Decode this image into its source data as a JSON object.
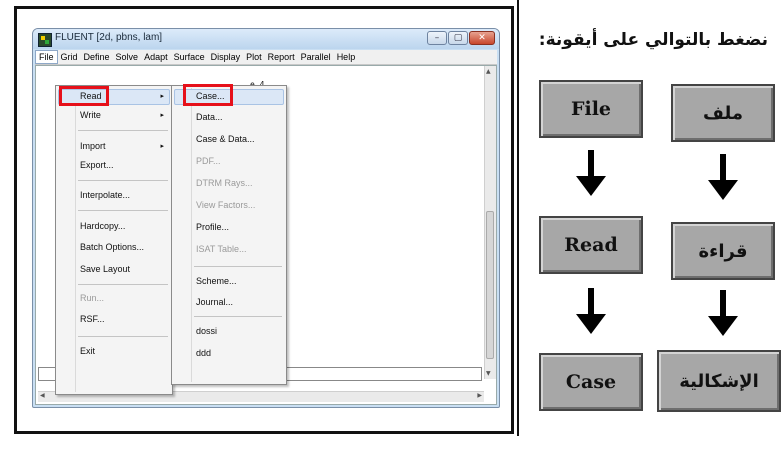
{
  "fluent_window": {
    "title": "FLUENT [2d, pbns, lam]",
    "controls": {
      "minimize": "–",
      "maximize": "▢",
      "close": "✕"
    },
    "menu_bar": [
      "File",
      "Grid",
      "Define",
      "Solve",
      "Adapt",
      "Surface",
      "Display",
      "Plot",
      "Report",
      "Parallel",
      "Help"
    ],
    "console_text": "e 4.\n  5.",
    "file_menu": {
      "items": [
        "Read",
        "Write",
        "Import",
        "Export...",
        "Interpolate...",
        "Hardcopy...",
        "Batch Options...",
        "Save Layout",
        "Run...",
        "RSF...",
        "Exit"
      ],
      "submenu_arrow": "▸"
    },
    "read_submenu": {
      "items": [
        "Case...",
        "Data...",
        "Case & Data...",
        "PDF...",
        "DTRM Rays...",
        "View Factors...",
        "Profile...",
        "ISAT Table...",
        "Scheme...",
        "Journal...",
        "dossi",
        "ddd"
      ]
    }
  },
  "instructions": {
    "heading": "نضغط بالتوالي على أيقونة:",
    "english_steps": [
      "File",
      "Read",
      "Case"
    ],
    "arabic_steps": [
      "ملف",
      "قراءة",
      "الإشكالية"
    ]
  }
}
